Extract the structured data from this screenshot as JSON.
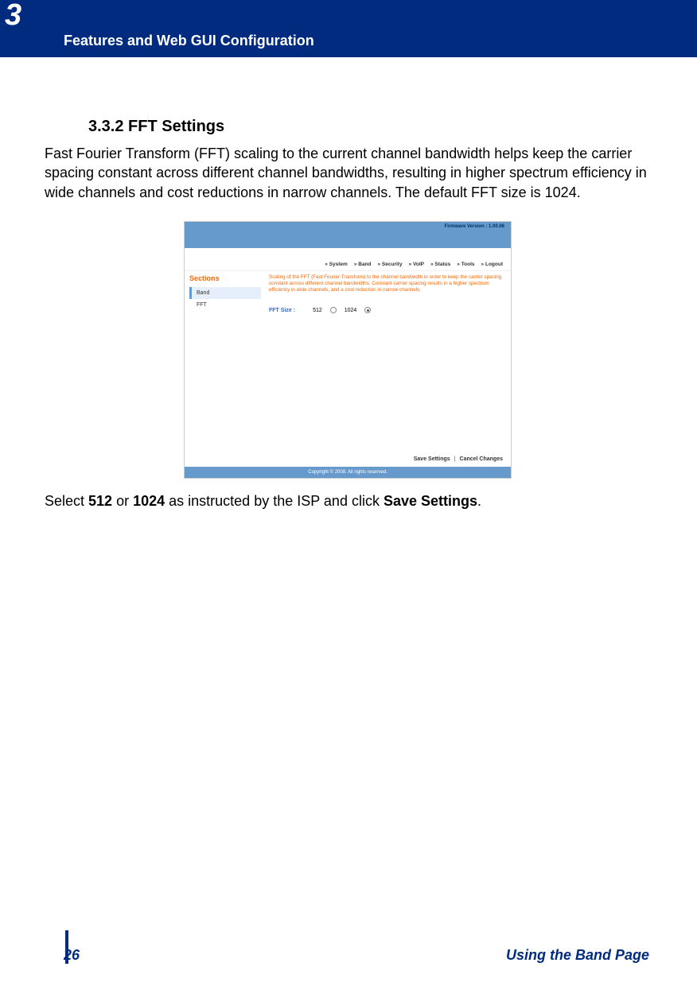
{
  "header": {
    "chapter_number": "3",
    "chapter_title": "Features and Web GUI Configuration"
  },
  "section": {
    "heading": "3.3.2 FFT Settings",
    "paragraph": "Fast Fourier Transform (FFT) scaling to the current channel bandwidth helps keep the carrier spacing constant across different channel bandwidths, resulting in higher spectrum efficiency in wide channels and cost reductions in narrow channels. The default FFT size is 1024."
  },
  "screenshot": {
    "firmware_version": "Firmware Version : 1.00.06",
    "nav": [
      "System",
      "Band",
      "Security",
      "VoIP",
      "Status",
      "Tools",
      "Logout"
    ],
    "sidebar": {
      "title": "Sections",
      "items": [
        {
          "label": "Band",
          "active": true
        },
        {
          "label": "FFT",
          "active": false
        }
      ]
    },
    "description": "Scaling of the FFT (Fast Fourier Transform) to the channel bandwidth in order to keep the carrier spacing constant across different channel bandwidths. Constant carrier spacing results in a higher spectrum efficiency in wide channels, and a cost reduction in narrow channels.",
    "fft_size_label": "FFT Size :",
    "options": {
      "opt1": "512",
      "opt2": "1024",
      "selected": "1024"
    },
    "actions": {
      "save": "Save Settings",
      "cancel": "Cancel Changes"
    },
    "copyright": "Copyright © 2008.  All rights reserved."
  },
  "instruction": {
    "prefix": "Select ",
    "b1": "512",
    "mid1": " or ",
    "b2": "1024",
    "mid2": " as instructed by the ISP and click ",
    "b3": "Save Settings",
    "suffix": "."
  },
  "footer": {
    "page_number": "26",
    "section_title": "Using the Band Page"
  }
}
